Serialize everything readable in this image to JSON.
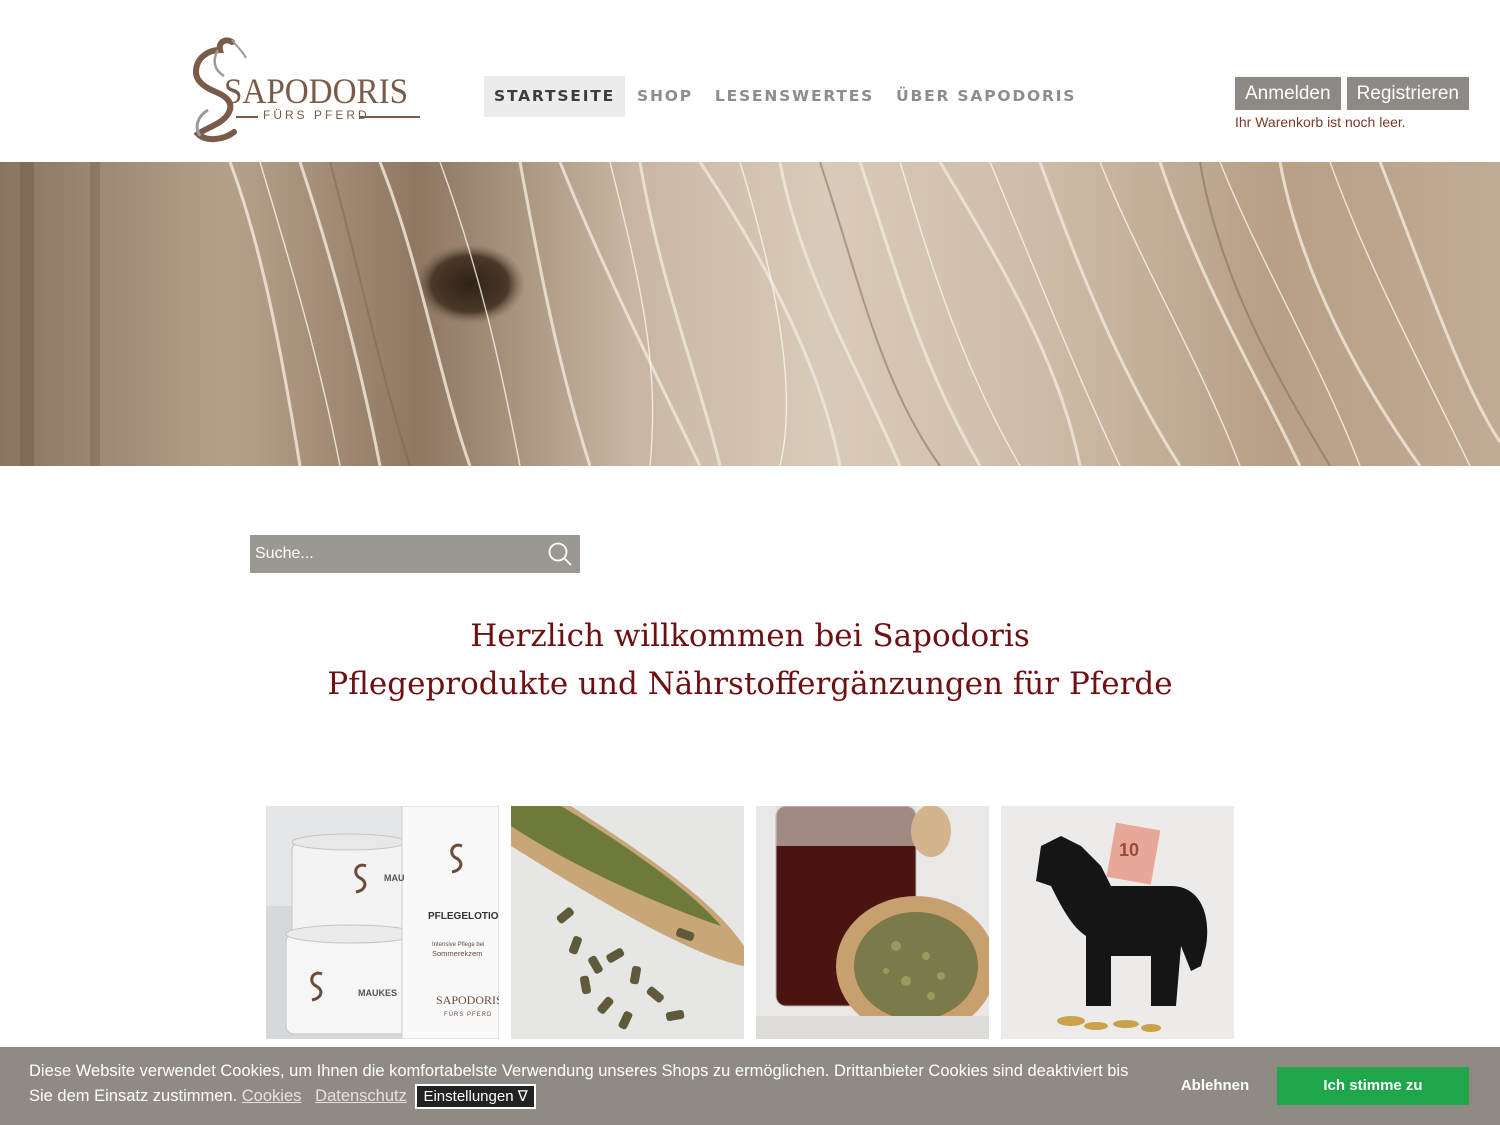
{
  "brand": {
    "name": "SAPODORIS",
    "tagline": "FÜRS PFERD",
    "logo_color": "#7a5a48"
  },
  "nav": {
    "items": [
      {
        "label": "STARTSEITE",
        "active": true
      },
      {
        "label": "SHOP",
        "active": false
      },
      {
        "label": "LESENSWERTES",
        "active": false
      },
      {
        "label": "ÜBER SAPODORIS",
        "active": false
      }
    ]
  },
  "account": {
    "login_label": "Anmelden",
    "register_label": "Registrieren",
    "cart_status": "Ihr Warenkorb ist noch leer."
  },
  "hero": {
    "image": "horse-mane-sepia"
  },
  "search": {
    "placeholder": "Suche...",
    "icon": "search-icon"
  },
  "welcome": {
    "line1": "Herzlich willkommen bei Sapodoris",
    "line2": "Pflegeprodukte und Nährstoffergänzungen für Pferde",
    "color": "#6e0f12"
  },
  "tiles": [
    {
      "image": "care-products-jars",
      "labels": [
        "MAUKESALBE",
        "PFLEGELOTION",
        "Intensive Pflege bei Sommerekzem",
        "SAPODORIS",
        "FÜRS PFERD"
      ]
    },
    {
      "image": "pellets-scoop"
    },
    {
      "image": "oil-and-herbs"
    },
    {
      "image": "horse-piggy-bank"
    }
  ],
  "cookie": {
    "text": "Diese Website verwendet Cookies, um Ihnen die komfortabelste Verwendung unseres Shops zu ermöglichen. Drittanbieter Cookies sind deaktiviert bis Sie dem Einsatz zustimmen.",
    "cookies_link": "Cookies",
    "privacy_link": "Datenschutz",
    "settings_label": "Einstellungen ∇",
    "reject_label": "Ablehnen",
    "accept_label": "Ich stimme zu",
    "accept_color": "#1fa64a"
  }
}
